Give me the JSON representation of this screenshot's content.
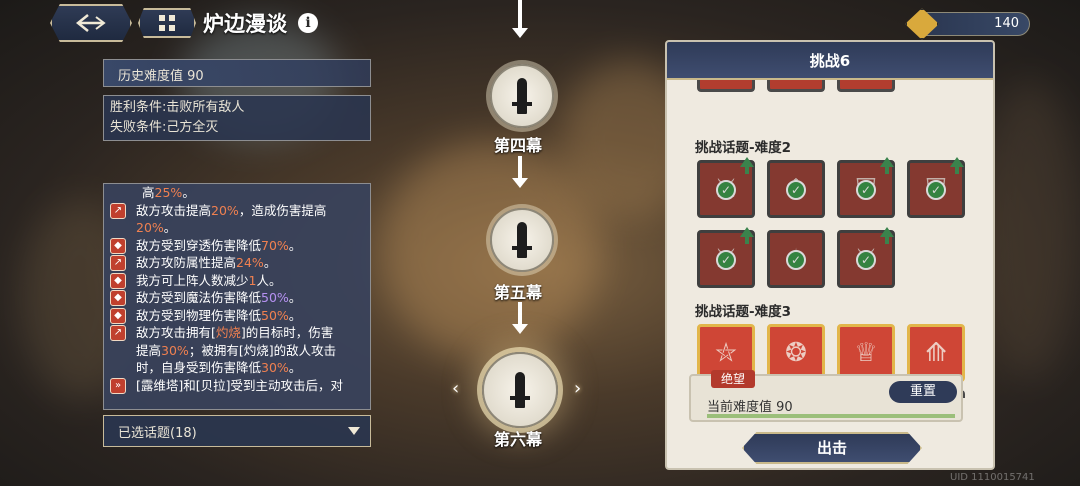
{
  "header": {
    "title": "炉边漫谈",
    "info_symbol": "i",
    "stamina_value": "140"
  },
  "left": {
    "history_label": "历史难度值 90",
    "win_condition": "胜利条件:击败所有敌人",
    "lose_condition": "失败条件:己方全灭",
    "effects": [
      {
        "pre": "高",
        "hl": "25%",
        "post": "。",
        "continuation": true
      },
      {
        "icon": "up-arrow",
        "pre": "敌方攻击提高",
        "hl": "20%",
        "post": "，造成伤害提高",
        "line2hl": "20%",
        "line2post": "。"
      },
      {
        "icon": "shield",
        "pre": "敌方受到穿透伤害降低",
        "hl": "70%",
        "post": "。"
      },
      {
        "icon": "up-arrow",
        "pre": "敌方攻防属性提高",
        "hl": "24%",
        "post": "。"
      },
      {
        "icon": "shield",
        "pre": "我方可上阵人数减少",
        "hl": "1",
        "post": "人。"
      },
      {
        "icon": "shield",
        "pre": "敌方受到魔法伤害降低",
        "hl_purple": "50%",
        "post": "。"
      },
      {
        "icon": "shield",
        "pre": "敌方受到物理伤害降低",
        "hl": "50%",
        "post": "。"
      },
      {
        "icon": "up-arrow",
        "text_burn": "敌方攻击拥有[灼烧]的目标时，伤害提高30%；被拥有[灼烧]的敌人攻击时，自身受到伤害降低30%。"
      },
      {
        "icon": "double-down",
        "text_plain": "[露维塔]和[贝拉]受到主动攻击后，对"
      }
    ],
    "burn_parts": {
      "a": "敌方攻击拥有[",
      "b": "灼烧",
      "c": "]的目标时，伤害",
      "d": "提高",
      "e": "30%",
      "f": "；被拥有[灼烧]的敌人攻击",
      "g": "时，自身受到伤害降低",
      "h": "30%",
      "i": "。"
    },
    "selected_topics": "已选话题(18)"
  },
  "route": {
    "nodes": [
      {
        "label": "第四幕"
      },
      {
        "label": "第五幕"
      },
      {
        "label": "第六幕",
        "active": true
      }
    ]
  },
  "challenge": {
    "title": "挑战6",
    "section2": "挑战话题-难度2",
    "section3": "挑战话题-难度3",
    "difficulty_tag": "绝望",
    "current_difficulty": "当前难度值 90",
    "reset_label": "重置",
    "go_label": "出击"
  },
  "footer": {
    "uid": "UID 1110015741"
  },
  "colors": {
    "accent_red": "#b23d2f",
    "highlight_orange": "#f08050",
    "highlight_purple": "#b691f2",
    "navy": "#2f3b58",
    "check_green": "#27a23b"
  }
}
